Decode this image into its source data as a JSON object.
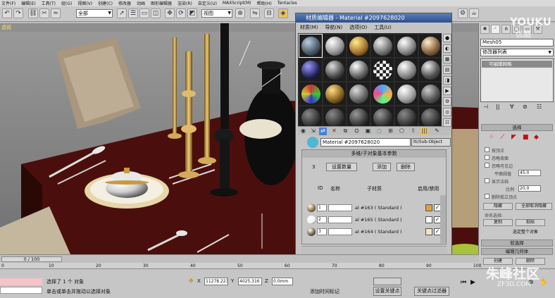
{
  "menubar": [
    "文件(F)",
    "编辑(E)",
    "工具(T)",
    "组(G)",
    "视图(V)",
    "创建(C)",
    "修改器",
    "动画",
    "图形编辑器",
    "渲染(R)",
    "自定义(U)",
    "MAXScript(M)",
    "帮助(H)",
    "Tentacles"
  ],
  "toolbar": {
    "selection_filter": "全部",
    "ref_coord": "视图"
  },
  "viewport": {
    "label": "透视"
  },
  "material_editor": {
    "title": "材质编辑器 - Material #2097628020",
    "menu": [
      "材质(M)",
      "导航(N)",
      "选项(O)",
      "工具(U)"
    ],
    "material_name": "Material #2097628020",
    "material_type": "lti/Sub-Object",
    "rollout_title": "多维/子对象基本参数",
    "count": "3",
    "set_count_label": "设置数量",
    "add_label": "添加",
    "delete_label": "删除",
    "columns": {
      "id": "ID",
      "name": "名称",
      "submaterial": "子材质",
      "onoff": "启用/禁用"
    },
    "rows": [
      {
        "id": "1",
        "submat": "al #163 ( Standard )",
        "color": "#e0a040",
        "swatch": "#8a6b3a",
        "checked": "✓"
      },
      {
        "id": "2",
        "submat": "al #165 ( Standard )",
        "color": "#ffffff",
        "swatch": "#f5f5f5",
        "checked": "✓"
      },
      {
        "id": "3",
        "submat": "al #164 ( Standard )",
        "color": "#f2e6c0",
        "swatch": "#6a5a40",
        "checked": "✓"
      }
    ]
  },
  "command_panel": {
    "object_name": "Mesh05",
    "modifier_list": "修改器列表",
    "stack_item": "可编辑网格",
    "selection_rollout": "选择",
    "by_vertex": "按顶点",
    "ignore_backface": "忽略背面",
    "ignore_visible_edges": "忽略可见边",
    "planar_threshold_label": "平面阈值",
    "planar_threshold": "45.0",
    "show_normals": "显示法线",
    "scale_label": "比例",
    "scale": "20.0",
    "delete_isolated": "删除孤立顶点",
    "hide_label": "隐藏",
    "unhide_all_label": "全部取消隐藏",
    "named_sel_label": "命名选择:",
    "copy_label": "复制",
    "paste_label": "粘贴",
    "selected_text": "选定整个对象",
    "soft_sel_rollout": "软选择",
    "edit_geom_rollout": "编辑几何体",
    "create_label": "创建",
    "delete_btn_label": "删除"
  },
  "timeline": {
    "position": "0 / 100",
    "ticks": [
      "0",
      "10",
      "20",
      "30",
      "40",
      "50",
      "60",
      "70",
      "80",
      "90",
      "100"
    ]
  },
  "status": {
    "selection": "选择了 1 个 对象",
    "prompt": "单击或单击并拖动以选择对象",
    "x": "11278.223",
    "y": "4025.316",
    "z": "0.0mm",
    "add_time_tag": "添加时间标记",
    "set_key": "设置关键点",
    "key_filters": "关键点过滤器"
  },
  "watermarks": {
    "youku": "YOUKU",
    "youku_sub": "优酷",
    "zhufeng": "朱峰社区",
    "zhufeng_url": "ZF3D.COM"
  }
}
